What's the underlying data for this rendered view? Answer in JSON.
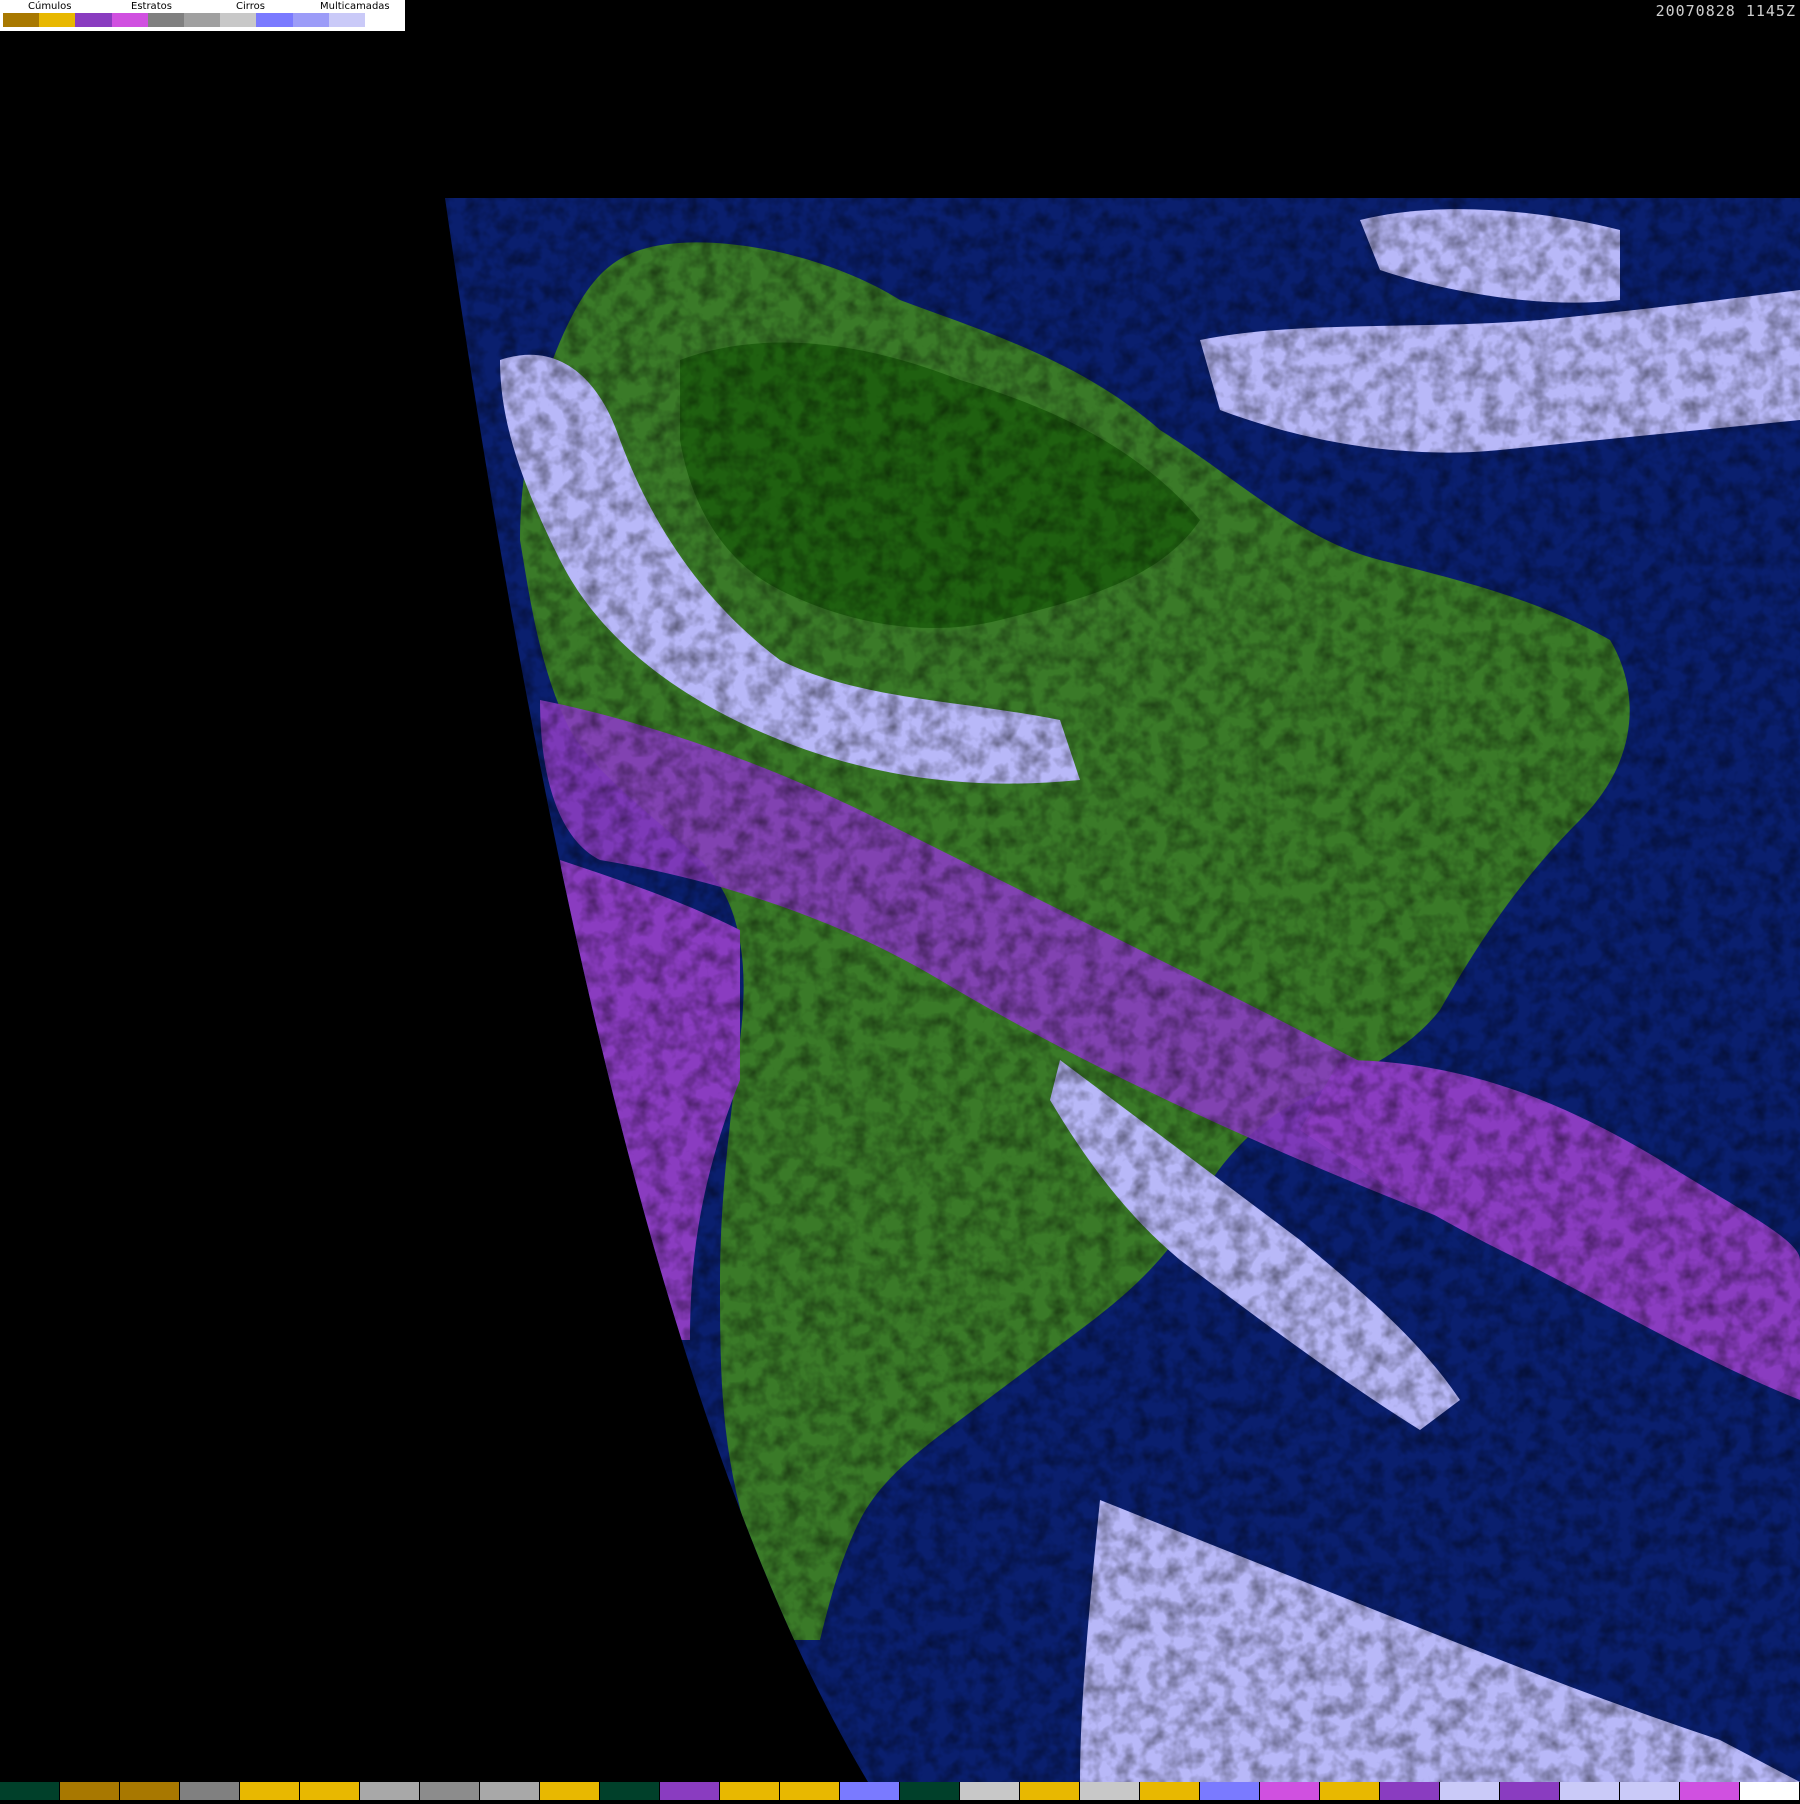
{
  "legend": {
    "groups": [
      {
        "label": "Cúmulos",
        "colors": [
          "#a87800",
          "#e8b800"
        ]
      },
      {
        "label": "Estratos",
        "colors": [
          "#8a3cc0",
          "#d050e0"
        ]
      },
      {
        "label": "Cirros",
        "colors": [
          "#808080",
          "#a0a0a0",
          "#c8c8c8"
        ]
      },
      {
        "label": "Multicamadas",
        "colors": [
          "#7a7aff",
          "#9c9cf8",
          "#cacaf8",
          "#ffffff"
        ]
      }
    ]
  },
  "timestamp": "20070828 1145Z",
  "colors": {
    "ocean": "#0a1f6e",
    "land": "#3a7a28",
    "land_dark": "#1f6010",
    "space": "#000000",
    "cumulus": "#c89000",
    "stratus": "#8a3cc0",
    "multilayer": "#b8b8f8",
    "cirrus": "#c0c0c0"
  },
  "bottom_strip": [
    "#00402a",
    "#a87800",
    "#a87800",
    "#808080",
    "#e8b800",
    "#e8b800",
    "#a8a8a8",
    "#8c8c8c",
    "#a8a8a8",
    "#e8b800",
    "#00402a",
    "#8a3cc0",
    "#e8b800",
    "#e8b800",
    "#7a7aff",
    "#00402a",
    "#c8c8c8",
    "#e8b800",
    "#c8c8c8",
    "#e8b800",
    "#7a7aff",
    "#d050e0",
    "#e8b800",
    "#8a3cc0",
    "#cacaf8",
    "#8a3cc0",
    "#cacaf8",
    "#cacaf8",
    "#d050e0",
    "#ffffff"
  ]
}
